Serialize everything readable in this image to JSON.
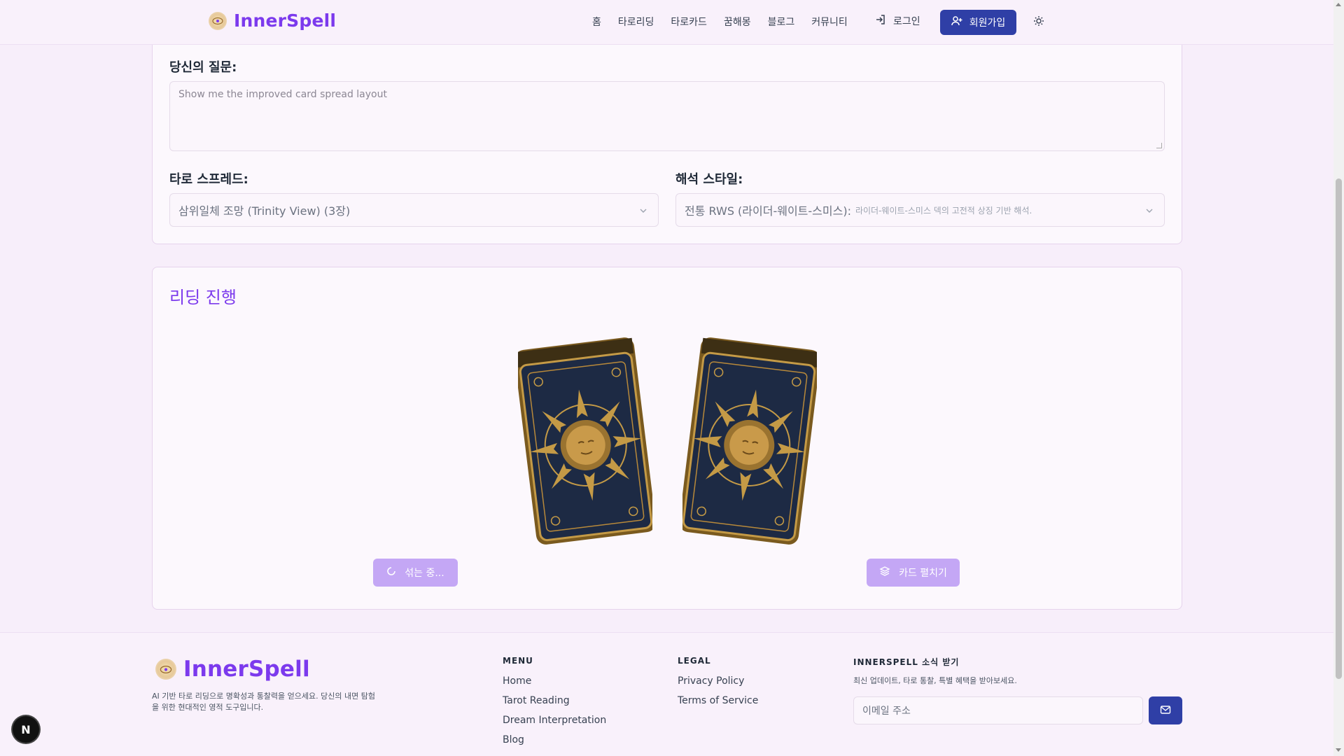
{
  "app": {
    "brand": "InnerSpell",
    "colors": {
      "brand_purple": "#7c3aed",
      "primary_button": "#2f3fa6",
      "light_button": "#c4a7f5",
      "background": "#f7eefa"
    }
  },
  "nav": {
    "links": [
      "홈",
      "타로리딩",
      "타로카드",
      "꿈해몽",
      "블로그",
      "커뮤니티"
    ],
    "login_label": "로그인",
    "signup_label": "회원가입",
    "icons": {
      "login": "login-icon",
      "signup": "user-plus-icon",
      "theme": "sun-icon"
    }
  },
  "form": {
    "question_label": "당신의 질문:",
    "question_placeholder": "Show me the improved card spread layout",
    "spread_label": "타로 스프레드:",
    "spread_value": "삼위일체 조망 (Trinity View) (3장)",
    "style_label": "해석 스타일:",
    "style_value": "전통 RWS (라이더-웨이트-스미스):",
    "style_desc": "라이더-웨이트-스미스 덱의 고전적 상징 기반 해석."
  },
  "reading": {
    "title": "리딩 진행",
    "shuffle_label": "섞는 중...",
    "spread_label": "카드 펼치기"
  },
  "footer": {
    "brand": "InnerSpell",
    "description": "AI 기반 타로 리딩으로 명확성과 통찰력을 얻으세요. 당신의 내면 탐험을 위한 현대적인 영적 도구입니다.",
    "menu_title": "MENU",
    "menu_links": [
      "Home",
      "Tarot Reading",
      "Dream Interpretation",
      "Blog"
    ],
    "legal_title": "LEGAL",
    "legal_links": [
      "Privacy Policy",
      "Terms of Service"
    ],
    "newsletter_title": "INNERSPELL 소식 받기",
    "newsletter_note": "최신 업데이트, 타로 통찰, 특별 혜택을 받아보세요.",
    "email_placeholder": "이메일 주소"
  },
  "dev_badge": "N"
}
